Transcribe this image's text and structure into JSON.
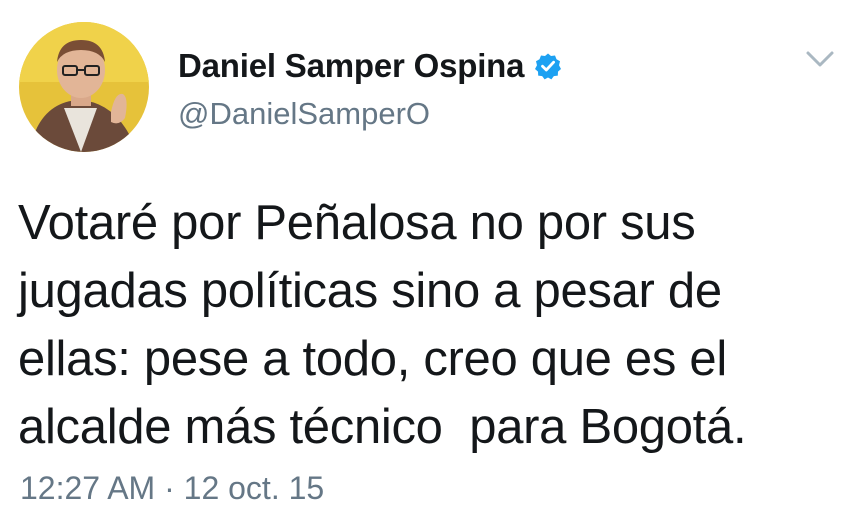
{
  "author": {
    "display_name": "Daniel Samper Ospina",
    "handle": "@DanielSamperO",
    "verified": true
  },
  "tweet": {
    "lines": [
      "Votaré por Peñalosa no por sus",
      "jugadas políticas sino a pesar de",
      "ellas: pese a todo, creo que es el",
      "alcalde más técnico  para Bogotá."
    ]
  },
  "meta": {
    "time": "12:27 AM",
    "separator": " · ",
    "date": "12 oct. 15"
  },
  "colors": {
    "text": "#14171a",
    "secondary": "#657786",
    "verified": "#1da1f2",
    "avatar_bg": "#e6c23a"
  },
  "icons": {
    "verified": "verified-badge-icon",
    "caret": "chevron-down-icon"
  }
}
